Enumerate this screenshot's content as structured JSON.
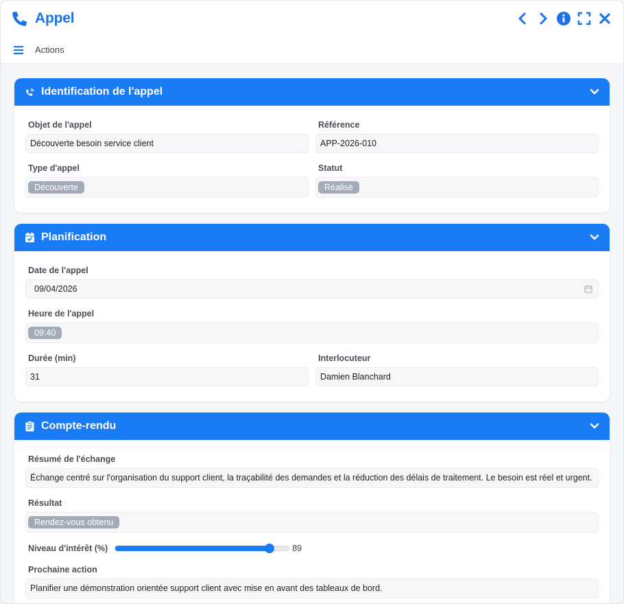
{
  "window": {
    "title": "Appel",
    "accent_color": "#1a7cf5",
    "title_icon": "phone-icon",
    "controls": [
      "prev-icon",
      "next-icon",
      "info-icon",
      "fullscreen-icon",
      "close-icon"
    ]
  },
  "toolbar": {
    "actions_label": "Actions",
    "menu_icon": "hamburger-icon"
  },
  "sections": {
    "identification": {
      "title": "Identification de l'appel",
      "icon": "phone-volume-icon",
      "objet_label": "Objet de l'appel",
      "objet_value": "Découverte besoin service client",
      "reference_label": "Référence",
      "reference_value": "APP-2026-010",
      "type_label": "Type d'appel",
      "type_value": "Découverte",
      "statut_label": "Statut",
      "statut_value": "Réalisé"
    },
    "planification": {
      "title": "Planification",
      "icon": "calendar-check-icon",
      "date_label": "Date de l'appel",
      "date_value": "09/04/2026",
      "heure_label": "Heure de l'appel",
      "heure_value": "09:40",
      "duree_label": "Durée (min)",
      "duree_value": "31",
      "interlocuteur_label": "Interlocuteur",
      "interlocuteur_value": "Damien Blanchard"
    },
    "compte_rendu": {
      "title": "Compte-rendu",
      "icon": "clipboard-icon",
      "resume_label": "Résumé de l'échange",
      "resume_value": "Échange centré sur l'organisation du support client, la traçabilité des demandes et la réduction des délais de traitement. Le besoin est réel et urgent.",
      "resultat_label": "Résultat",
      "resultat_value": "Rendez-vous obtenu",
      "interet_label": "Niveau d'intérêt (%)",
      "interet_value": 89,
      "interet_display": "89",
      "prochaine_label": "Prochaine action",
      "prochaine_value": "Planifier une démonstration orientée support client avec mise en avant des tableaux de bord."
    }
  }
}
